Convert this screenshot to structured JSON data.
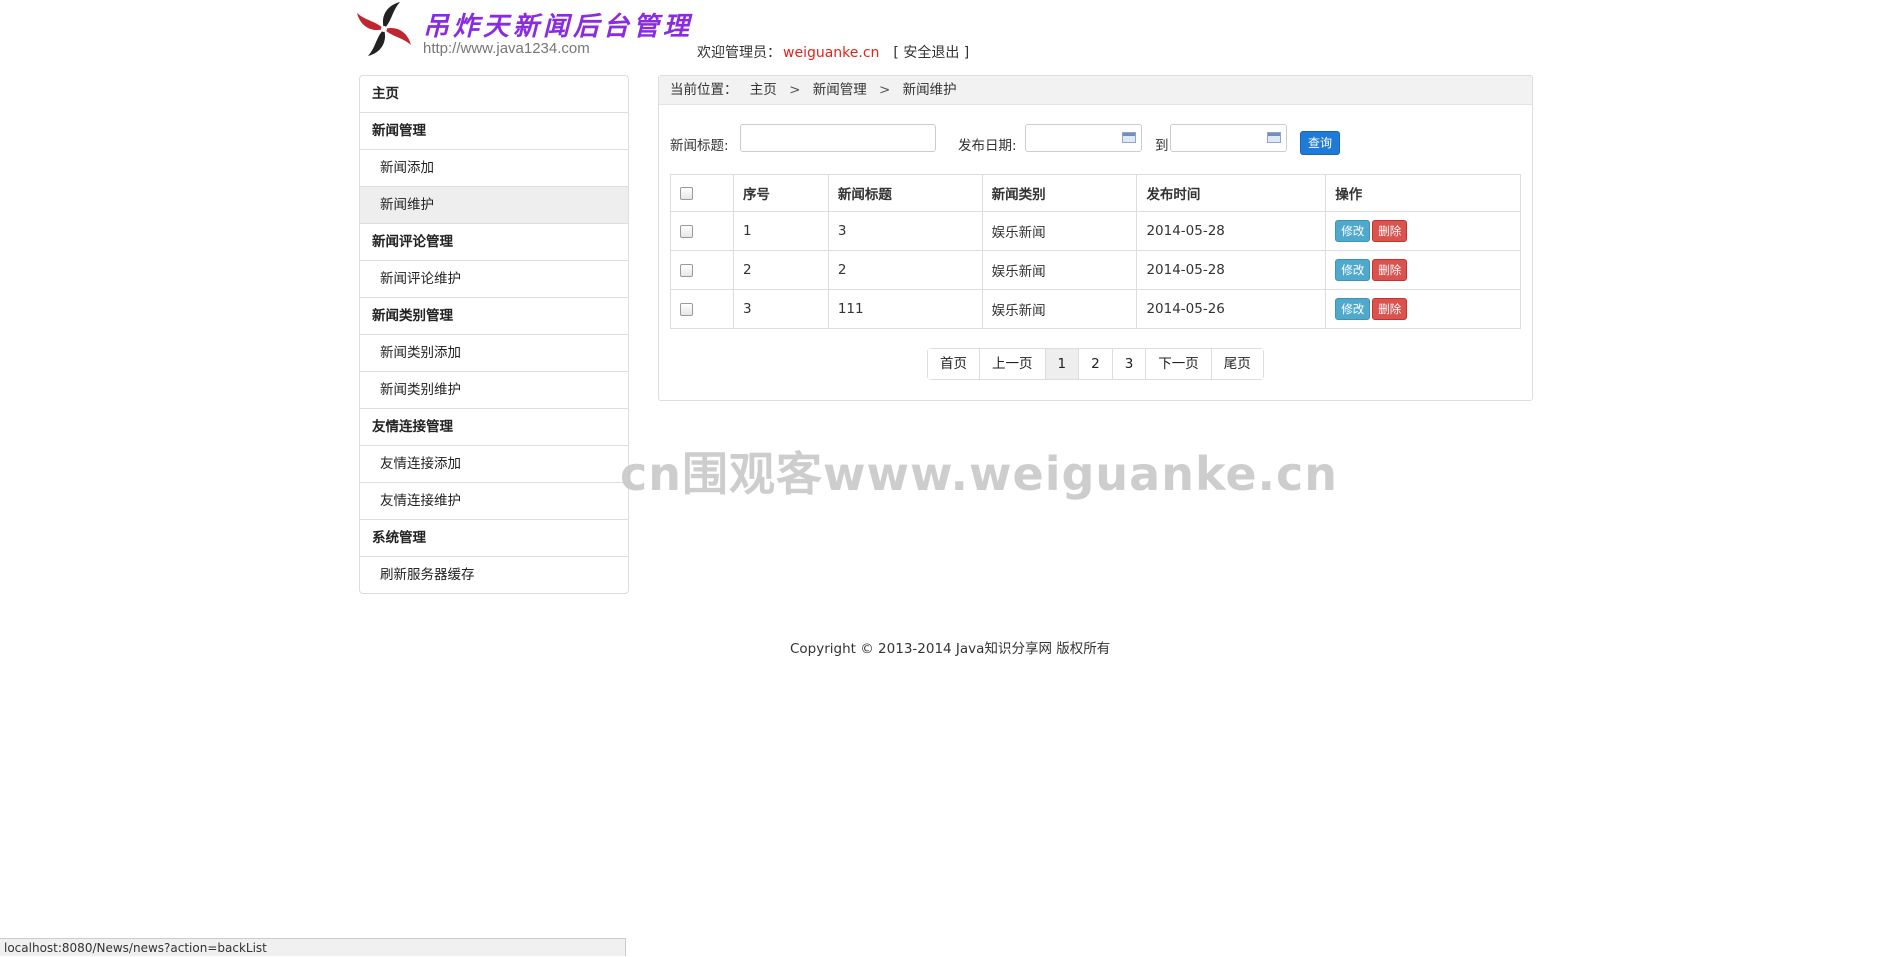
{
  "header": {
    "title": "吊炸天新闻后台管理",
    "url": "http://www.java1234.com",
    "welcome_label": "欢迎管理员：",
    "user": "weiguanke.cn",
    "logout": "[ 安全退出 ]"
  },
  "sidebar": {
    "items": [
      {
        "label": "主页"
      },
      {
        "label": "新闻管理"
      },
      {
        "label": "新闻添加"
      },
      {
        "label": "新闻维护"
      },
      {
        "label": "新闻评论管理"
      },
      {
        "label": "新闻评论维护"
      },
      {
        "label": "新闻类别管理"
      },
      {
        "label": "新闻类别添加"
      },
      {
        "label": "新闻类别维护"
      },
      {
        "label": "友情连接管理"
      },
      {
        "label": "友情连接添加"
      },
      {
        "label": "友情连接维护"
      },
      {
        "label": "系统管理"
      },
      {
        "label": "刷新服务器缓存"
      }
    ]
  },
  "breadcrumb": {
    "prefix": "当前位置：",
    "items": [
      "主页",
      "新闻管理",
      "新闻维护"
    ],
    "separator": ">"
  },
  "search": {
    "title_label": "新闻标题:",
    "title_value": "",
    "date_label": "发布日期:",
    "start_value": "",
    "to_label": "到",
    "end_value": "",
    "query_button": "查询"
  },
  "table": {
    "headers": [
      "序号",
      "新闻标题",
      "新闻类别",
      "发布时间",
      "操作"
    ],
    "rows": [
      {
        "no": "1",
        "title": "3",
        "category": "娱乐新闻",
        "date": "2014-05-28"
      },
      {
        "no": "2",
        "title": "2",
        "category": "娱乐新闻",
        "date": "2014-05-28"
      },
      {
        "no": "3",
        "title": "111",
        "category": "娱乐新闻",
        "date": "2014-05-26"
      }
    ],
    "edit_label": "修改",
    "delete_label": "删除"
  },
  "pager": {
    "first": "首页",
    "prev": "上一页",
    "pages": [
      "1",
      "2",
      "3"
    ],
    "current": "1",
    "next": "下一页",
    "last": "尾页"
  },
  "watermark": "cn围观客www.weiguanke.cn",
  "footer": "Copyright © 2013-2014 Java知识分享网 版权所有",
  "status_bar": "localhost:8080/News/news?action=backList",
  "colors": {
    "user": "#e5231a",
    "query_button": "#1f7bd6",
    "edit_button": "#4ea9cd",
    "delete_button": "#d9534f",
    "logo_title": "#8a2be2"
  }
}
